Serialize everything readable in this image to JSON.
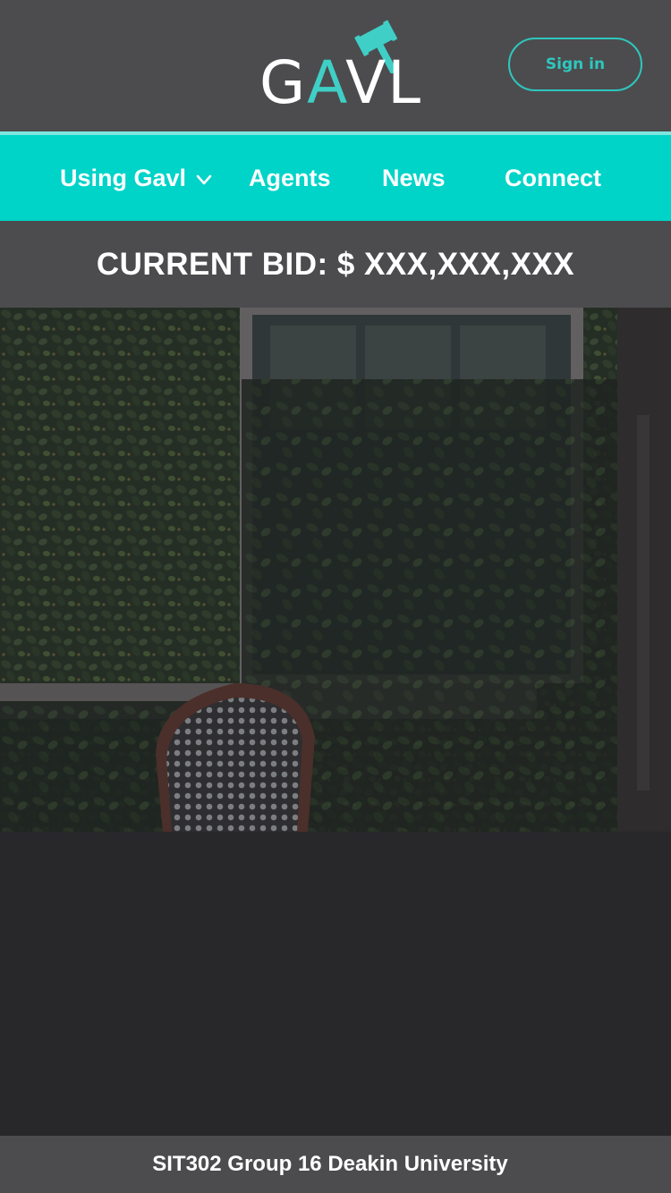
{
  "header": {
    "logo_text": {
      "g": "G",
      "a": "A",
      "vl": "VL"
    },
    "signin_label": "Sign in"
  },
  "nav": {
    "items": [
      {
        "label": "Using Gavl",
        "has_dropdown": true
      },
      {
        "label": "Agents"
      },
      {
        "label": "News"
      },
      {
        "label": "Connect"
      }
    ]
  },
  "bid": {
    "text": "CURRENT BID: $ XXX,XXX,XXX"
  },
  "hero": {
    "icon": "property-photo"
  },
  "footer": {
    "text": "SIT302 Group 16 Deakin University"
  },
  "colors": {
    "accent": "#00d3c8",
    "header_bg": "#4c4c4e",
    "body_bg": "#28272a"
  }
}
